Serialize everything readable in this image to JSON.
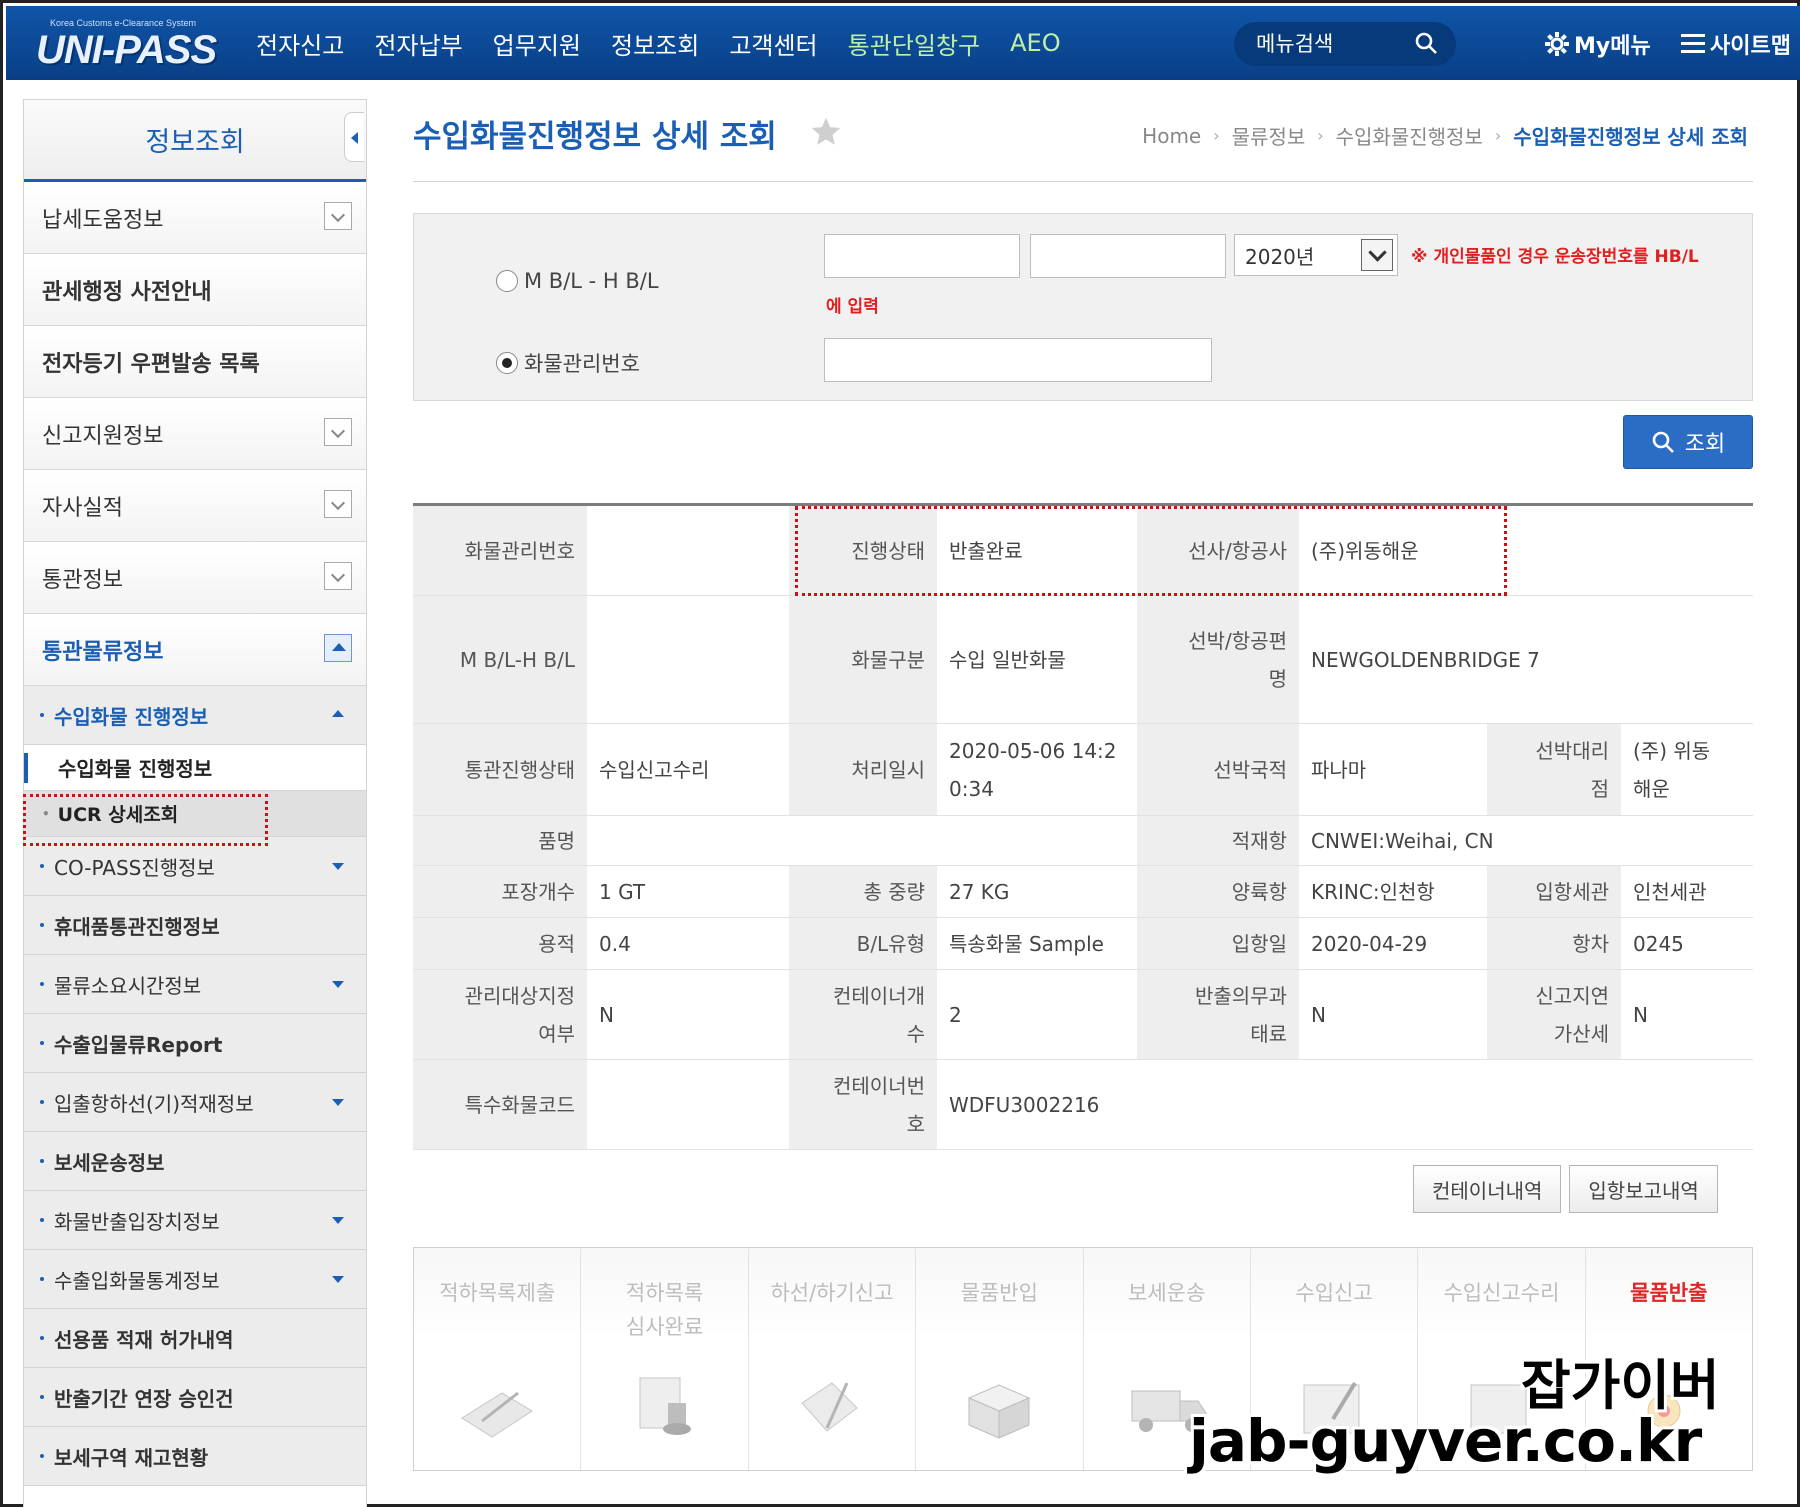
{
  "header": {
    "logo_small": "Korea Customs e-Clearance System",
    "logo_main": "UNI-PASS",
    "nav": [
      "전자신고",
      "전자납부",
      "업무지원",
      "정보조회",
      "고객센터",
      "통관단일창구",
      "AEO"
    ],
    "search_placeholder": "메뉴검색",
    "mymenu": "My메뉴",
    "sitemap": "사이트맵"
  },
  "sidebar": {
    "title": "정보조회",
    "items": [
      "납세도움정보",
      "관세행정 사전안내",
      "전자등기 우편발송 목록",
      "신고지원정보",
      "자사실적",
      "통관정보",
      "통관물류정보"
    ],
    "sub_items": [
      "수입화물 진행정보",
      "CO-PASS진행정보",
      "휴대품통관진행정보",
      "물류소요시간정보",
      "수출입물류Report",
      "입출항하선(기)적재정보",
      "보세운송정보",
      "화물반출입장치정보",
      "수출입화물통계정보",
      "선용품 적재 허가내역",
      "반출기간 연장 승인건",
      "보세구역 재고현황"
    ],
    "sub3": [
      "수입화물 진행정보",
      "UCR 상세조회"
    ]
  },
  "page": {
    "title": "수입화물진행정보 상세 조회",
    "breadcrumb": [
      "Home",
      "물류정보",
      "수입화물진행정보",
      "수입화물진행정보 상세 조회"
    ]
  },
  "search": {
    "radio_mbl": "M B/L - H B/L",
    "radio_cargo": "화물관리번호",
    "year": "2020년",
    "notice_1": "※ 개인물품인 경우 운송장번호를 HB/L",
    "notice_2": "에 입력",
    "button": "조회"
  },
  "detail": {
    "r1": {
      "h1": "화물관리번호",
      "v1": "",
      "h2": "진행상태",
      "v2": "반출완료",
      "h3": "선사/항공사",
      "v3": "(주)위동해운"
    },
    "r2": {
      "h1": "M B/L-H B/L",
      "v1": "",
      "h2": "화물구분",
      "v2": "수입 일반화물",
      "h3a": "선박/항공편",
      "h3b": "명",
      "v3": "NEWGOLDENBRIDGE 7"
    },
    "r3": {
      "h1": "통관진행상태",
      "v1": "수입신고수리",
      "h2": "처리일시",
      "v2a": "2020-05-06 14:2",
      "v2b": "0:34",
      "h3": "선박국적",
      "v3": "파나마",
      "h4a": "선박대리",
      "h4b": "점",
      "v4a": "(주) 위동",
      "v4b": "해운"
    },
    "r4": {
      "h1": "품명",
      "v1": "",
      "h3": "적재항",
      "v3": "CNWEI:Weihai, CN"
    },
    "r5": {
      "h1": "포장개수",
      "v1": "1 GT",
      "h2": "총 중량",
      "v2": "27 KG",
      "h3": "양륙항",
      "v3": "KRINC:인천항",
      "h4": "입항세관",
      "v4": "인천세관"
    },
    "r6": {
      "h1": "용적",
      "v1": "0.4",
      "h2": "B/L유형",
      "v2": "특송화물 Sample",
      "h3": "입항일",
      "v3": "2020-04-29",
      "h4": "항차",
      "v4": "0245"
    },
    "r7": {
      "h1a": "관리대상지정",
      "h1b": "여부",
      "v1": "N",
      "h2a": "컨테이너개",
      "h2b": "수",
      "v2": "2",
      "h3a": "반출의무과",
      "h3b": "태료",
      "v3": "N",
      "h4a": "신고지연",
      "h4b": "가산세",
      "v4": "N"
    },
    "r8": {
      "h1": "특수화물코드",
      "v1": "",
      "h2a": "컨테이너번",
      "h2b": "호",
      "v2": "WDFU3002216"
    }
  },
  "buttons": {
    "container": "컨테이너내역",
    "arrival": "입항보고내역"
  },
  "steps": [
    {
      "label": "적하목록제출",
      "icon": "clipboard-pen-icon"
    },
    {
      "label": "적하목록\n심사완료",
      "icon": "stamp-icon"
    },
    {
      "label": "하선/하기신고",
      "icon": "document-pen-icon"
    },
    {
      "label": "물품반입",
      "icon": "box-icon"
    },
    {
      "label": "보세운송",
      "icon": "truck-icon"
    },
    {
      "label": "수입신고",
      "icon": "form-icon"
    },
    {
      "label": "수입신고수리",
      "icon": "approval-icon"
    },
    {
      "label": "물품반출",
      "icon": "release-icon"
    }
  ],
  "watermark": {
    "line1": "잡가이버",
    "line2": "jab-guyver.co.kr"
  },
  "colors": {
    "brand": "#0f55a8",
    "accent_blue": "#1b5fb4",
    "alert_red": "#e02020"
  }
}
